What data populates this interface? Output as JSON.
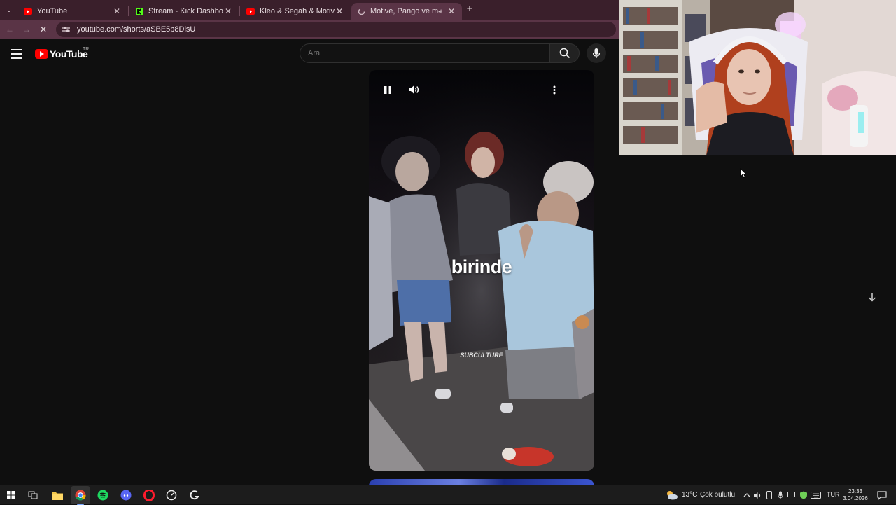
{
  "browser": {
    "tabs": [
      {
        "title": "YouTube",
        "icon": "youtube-favicon",
        "active": false
      },
      {
        "title": "Stream - Kick Dashboard",
        "icon": "kick-favicon",
        "active": false
      },
      {
        "title": "Kleo & Segah & Motive - A La",
        "icon": "youtube-favicon",
        "active": false
      },
      {
        "title": "Motive, Pango ve manifest",
        "icon": "loading-favicon",
        "active": true
      }
    ],
    "url": "youtube.com/shorts/aSBE5b8DlsU"
  },
  "youtube": {
    "logo_text": "YouTube",
    "country_code": "TR",
    "search_placeholder": "Ara"
  },
  "short": {
    "overlay_text": "birinde",
    "watermark": "SUBCULTURE"
  },
  "taskbar": {
    "weather_temp": "13°C",
    "weather_desc": "Çok bulutlu",
    "language": "TUR",
    "time": "23:33",
    "date": "3.04.2026"
  },
  "colors": {
    "youtube_red": "#ff0000",
    "chrome_tabbar": "#3a1f2b",
    "chrome_toolbar": "#5a3446",
    "yt_background": "#0f0f0f"
  }
}
